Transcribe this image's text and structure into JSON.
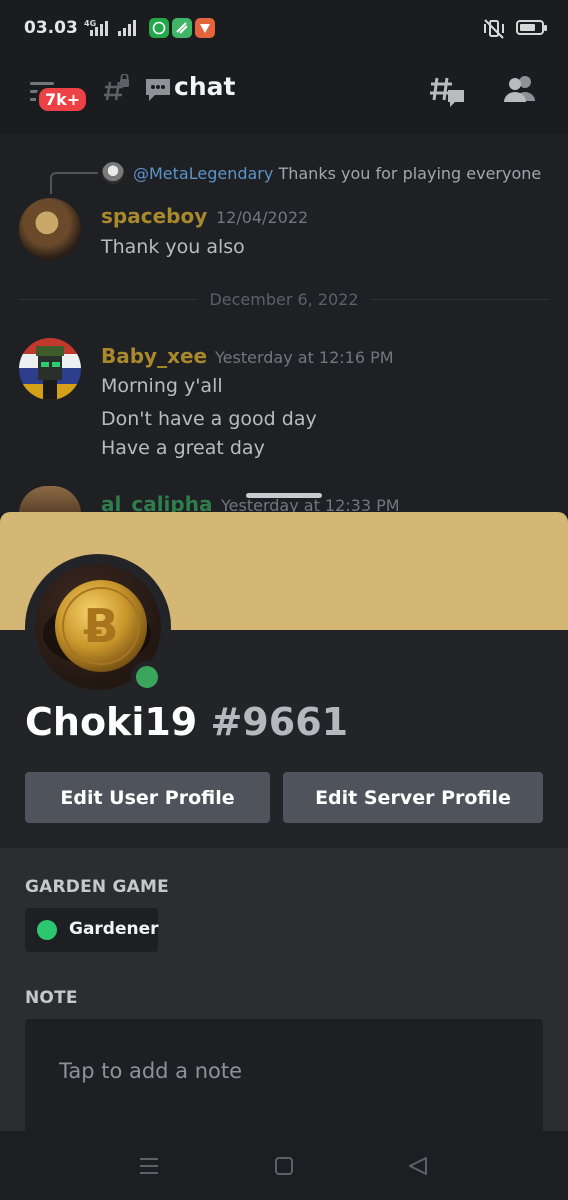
{
  "status_bar": {
    "time": "03.03",
    "network_type": "4G",
    "app_icons": [
      "green-chat-app-icon",
      "green-app-icon",
      "orange-app-icon"
    ],
    "icons": [
      "signal-icon",
      "wifi-signal-icon",
      "mute-vibrate-icon",
      "battery-icon"
    ]
  },
  "header": {
    "unread_badge": "7k+",
    "channel_name": "chat",
    "icons": [
      "menu-icon",
      "locked-channel-icon",
      "threads-icon",
      "members-icon"
    ]
  },
  "messages": [
    {
      "reply": {
        "mention": "@MetaLegendary",
        "text": "Thanks you for playing everyone"
      },
      "username": "spaceboy",
      "timestamp": "12/04/2022",
      "lines": [
        "Thank you also"
      ]
    },
    {
      "username": "Baby_xee",
      "timestamp": "Yesterday at 12:16 PM",
      "lines": [
        "Morning y'all",
        "Don't have a good day",
        "Have a great day"
      ]
    },
    {
      "username": "al_calipha",
      "timestamp": "Yesterday at 12:33 PM",
      "lines": []
    }
  ],
  "date_divider": "December 6, 2022",
  "profile": {
    "banner_color": "#d4b774",
    "name": "Choki19",
    "discriminator": "#9661",
    "status": "online",
    "buttons": {
      "edit_user": "Edit User Profile",
      "edit_server": "Edit Server Profile"
    },
    "sections": {
      "server_title": "GARDEN GAME",
      "role": "Gardener",
      "role_color": "#2dc770",
      "note_title": "NOTE",
      "note_placeholder": "Tap to add a note"
    }
  },
  "colors": {
    "background": "#17181b",
    "username_gold": "#a8892c",
    "mention_blue": "#5b93c9",
    "online_green": "#3ba55d",
    "button_gray": "#4f545c"
  },
  "nav_bar": {
    "icons": [
      "recent-apps-icon",
      "home-icon",
      "back-icon"
    ]
  }
}
